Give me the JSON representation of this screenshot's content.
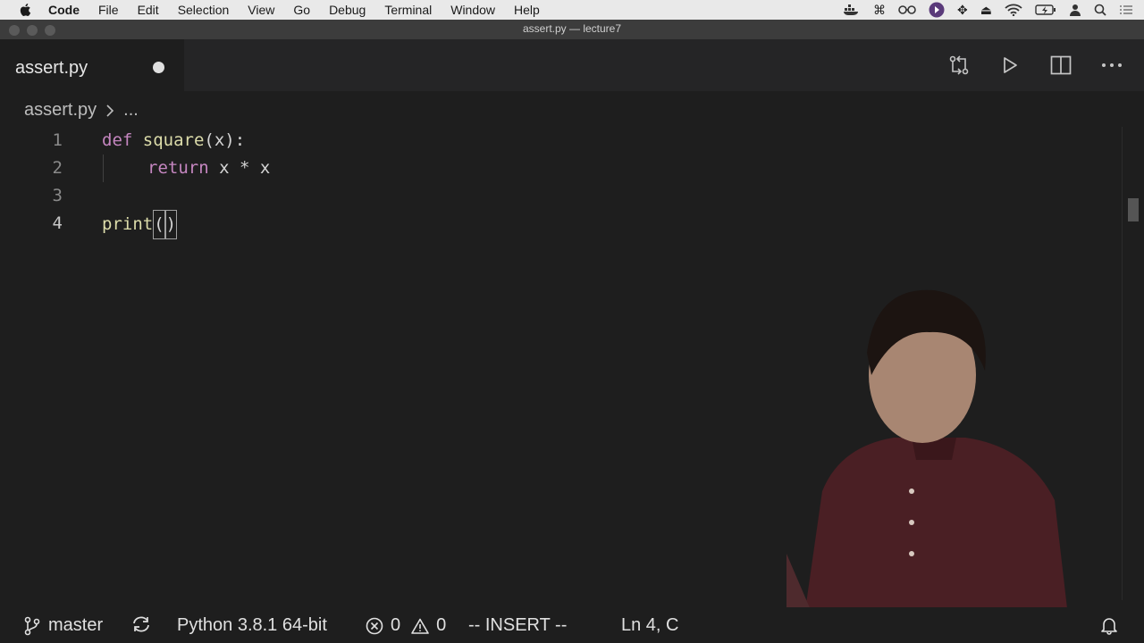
{
  "menubar": {
    "app": "Code",
    "items": [
      "File",
      "Edit",
      "Selection",
      "View",
      "Go",
      "Debug",
      "Terminal",
      "Window",
      "Help"
    ]
  },
  "window": {
    "title": "assert.py — lecture7"
  },
  "tab": {
    "label": "assert.py"
  },
  "breadcrumb": {
    "file": "assert.py",
    "ellipsis": "..."
  },
  "editor": {
    "lines": [
      {
        "num": "1",
        "kw": "def",
        "fn": "square",
        "rest": "(x):"
      },
      {
        "num": "2",
        "kw": "return",
        "rest": " x * x"
      },
      {
        "num": "3"
      },
      {
        "num": "4",
        "fn": "print",
        "open": "(",
        "close": ")"
      }
    ]
  },
  "statusbar": {
    "branch": "master",
    "python": "Python 3.8.1 64-bit",
    "errors": "0",
    "warnings": "0",
    "mode": "-- INSERT --",
    "position": "Ln 4, C"
  },
  "colors": {
    "keyword": "#c586c0",
    "function": "#dcdcaa",
    "text": "#d4d4d4"
  }
}
